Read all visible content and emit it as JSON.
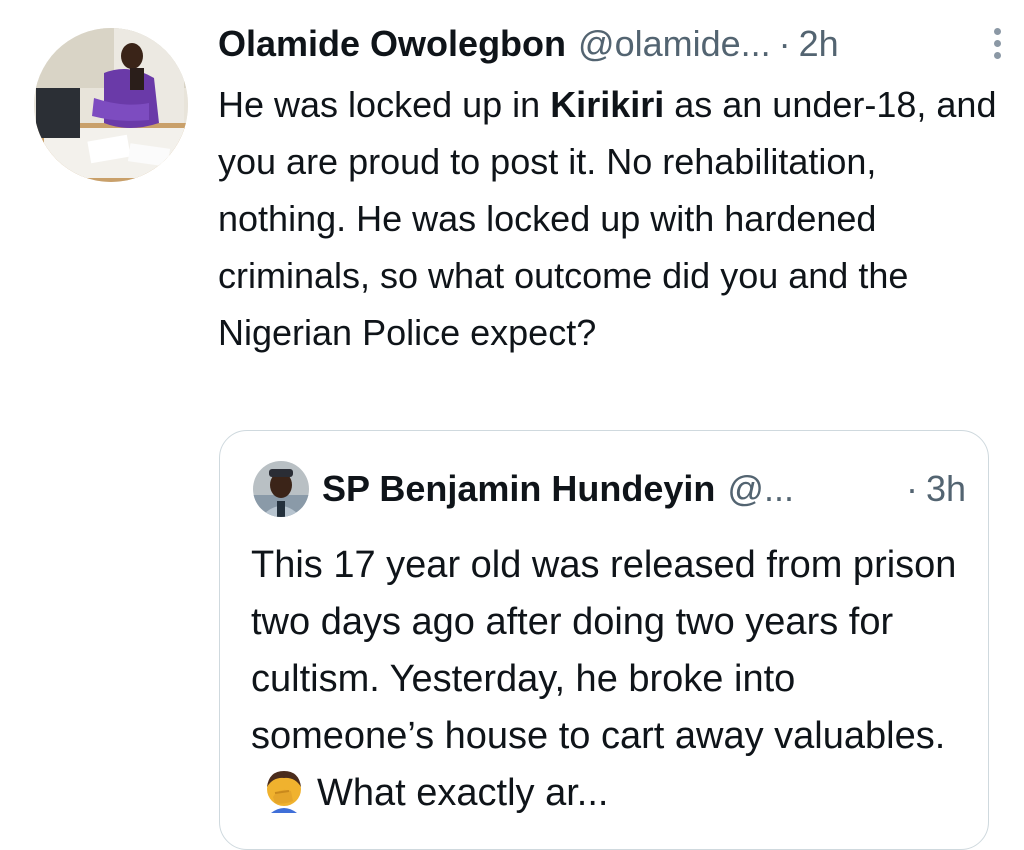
{
  "tweet": {
    "author_name": "Olamide Owolegbon",
    "author_handle": "@olamide...",
    "separator": "·",
    "time": "2h",
    "text_before_bold": "He was locked up in ",
    "text_bold": "Kirikiri",
    "text_after_bold": " as an under-18, and you are proud to post it. No rehabilitation, nothing. He was locked up with hardened criminals, so what outcome did you and the Nigerian Police expect?",
    "more_icon": "more-vertical-icon"
  },
  "quoted_tweet": {
    "author_name": "SP Benjamin Hundeyin",
    "author_handle": "@...",
    "separator": "·",
    "time": "3h",
    "text_main": "This 17 year old was released from prison two days ago after doing two years for cultism. Yesterday, he broke into someone’s house to cart away valuables.",
    "emoji": "man-facepalming-emoji",
    "text_tail": "What exactly ar..."
  }
}
